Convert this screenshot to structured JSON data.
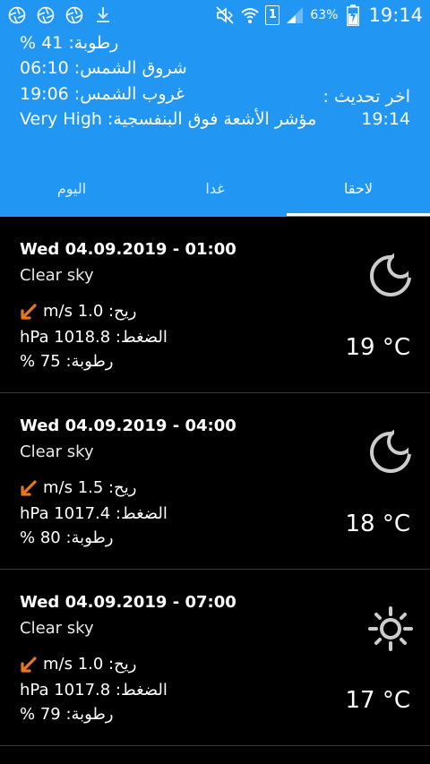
{
  "status_bar": {
    "battery_percent": "63%",
    "time": "19:14",
    "sim_label": "1"
  },
  "header": {
    "humidity_line": "رطوبة: 41 %",
    "sunrise_line": "شروق الشمس: 06:10",
    "sunset_line": "غروب الشمس: 19:06",
    "uv_line": "مؤشر الأشعة فوق البنفسجية: Very High",
    "last_update_label": "اخر تحديث :",
    "last_update_time": "19:14"
  },
  "tabs": [
    {
      "label": "اليوم"
    },
    {
      "label": "غدا"
    },
    {
      "label": "لاحقا"
    }
  ],
  "forecasts": [
    {
      "datetime": "Wed 04.09.2019 - 01:00",
      "description": "Clear sky",
      "wind": "ريح: m/s 1.0",
      "pressure": "الضغط: hPa 1018.8",
      "humidity": "رطوبة: 75 %",
      "temperature": "19 °C",
      "icon": "moon-icon"
    },
    {
      "datetime": "Wed 04.09.2019 - 04:00",
      "description": "Clear sky",
      "wind": "ريح: m/s 1.5",
      "pressure": "الضغط: hPa 1017.4",
      "humidity": "رطوبة: 80 %",
      "temperature": "18 °C",
      "icon": "moon-icon"
    },
    {
      "datetime": "Wed 04.09.2019 - 07:00",
      "description": "Clear sky",
      "wind": "ريح: m/s 1.0",
      "pressure": "الضغط: hPa 1017.8",
      "humidity": "رطوبة: 79 %",
      "temperature": "17 °C",
      "icon": "sun-icon"
    }
  ],
  "colors": {
    "accent": "#2196f3",
    "wind_arrow": "#e8761c",
    "background": "#000000"
  }
}
